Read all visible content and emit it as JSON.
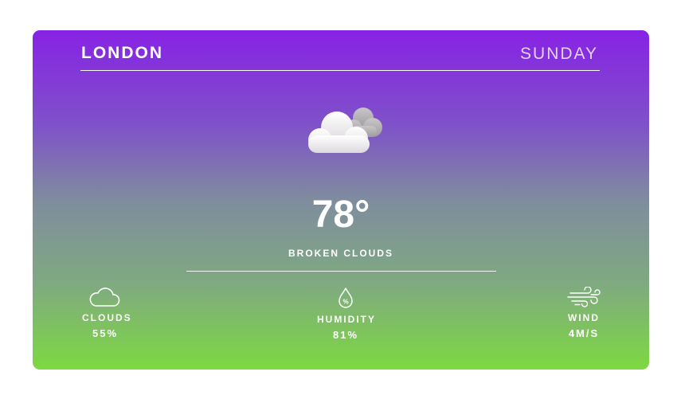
{
  "location": {
    "city": "LONDON",
    "day": "SUNDAY"
  },
  "current": {
    "icon": "broken-clouds-icon",
    "temperature": "78°",
    "description": "BROKEN CLOUDS"
  },
  "stats": {
    "clouds": {
      "label": "CLOUDS",
      "value": "55%",
      "icon": "cloud-outline-icon"
    },
    "humidity": {
      "label": "HUMIDITY",
      "value": "81%",
      "icon": "droplet-percent-icon"
    },
    "wind": {
      "label": "WIND",
      "value": "4M/S",
      "icon": "wind-icon"
    }
  },
  "colors": {
    "gradient_top": "#8722e4",
    "gradient_bottom": "#7ed941",
    "text": "#ffffff"
  }
}
